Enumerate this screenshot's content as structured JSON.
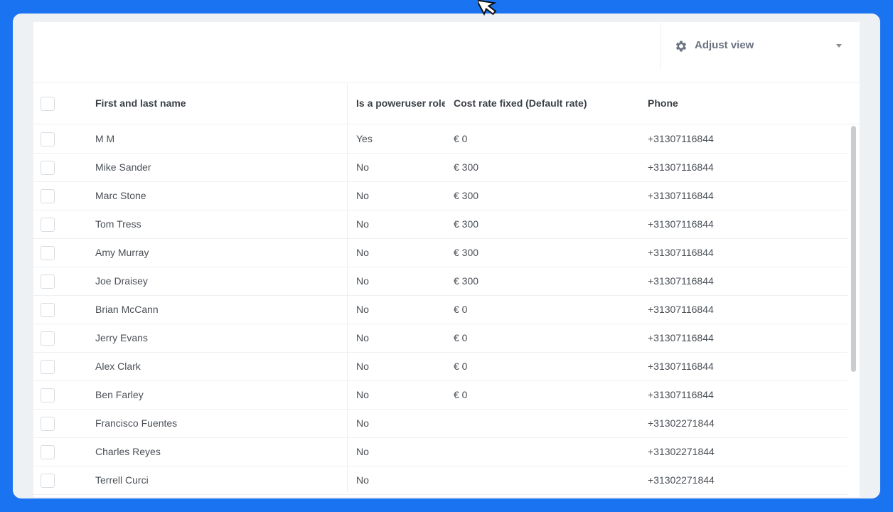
{
  "toolbar": {
    "adjust_view_label": "Adjust view",
    "adjust_view_icon": "gear-icon",
    "dropdown_icon": "chevron-down-icon"
  },
  "table": {
    "columns": [
      "First and last name",
      "Is a poweruser role i",
      "Cost rate fixed (Default rate)",
      "Phone"
    ],
    "rows": [
      {
        "name": "M M",
        "poweruser": "Yes",
        "cost": "€ 0",
        "phone": "+31307116844"
      },
      {
        "name": "Mike Sander",
        "poweruser": "No",
        "cost": "€ 300",
        "phone": "+31307116844"
      },
      {
        "name": "Marc Stone",
        "poweruser": "No",
        "cost": "€ 300",
        "phone": "+31307116844"
      },
      {
        "name": "Tom Tress",
        "poweruser": "No",
        "cost": "€ 300",
        "phone": "+31307116844"
      },
      {
        "name": "Amy Murray",
        "poweruser": "No",
        "cost": "€ 300",
        "phone": "+31307116844"
      },
      {
        "name": "Joe Draisey",
        "poweruser": "No",
        "cost": "€ 300",
        "phone": "+31307116844"
      },
      {
        "name": "Brian McCann",
        "poweruser": "No",
        "cost": "€ 0",
        "phone": "+31307116844"
      },
      {
        "name": "Jerry Evans",
        "poweruser": "No",
        "cost": "€ 0",
        "phone": "+31307116844"
      },
      {
        "name": "Alex Clark",
        "poweruser": "No",
        "cost": "€ 0",
        "phone": "+31307116844"
      },
      {
        "name": "Ben Farley",
        "poweruser": "No",
        "cost": "€ 0",
        "phone": "+31307116844"
      },
      {
        "name": "Francisco Fuentes",
        "poweruser": "No",
        "cost": "",
        "phone": "+31302271844"
      },
      {
        "name": "Charles Reyes",
        "poweruser": "No",
        "cost": "",
        "phone": "+31302271844"
      },
      {
        "name": "Terrell Curci",
        "poweruser": "No",
        "cost": "",
        "phone": "+31302271844"
      }
    ]
  },
  "colors": {
    "background": "#1a73f0",
    "card": "#eef1f4",
    "panel": "#ffffff",
    "text": "#4a4f55"
  }
}
